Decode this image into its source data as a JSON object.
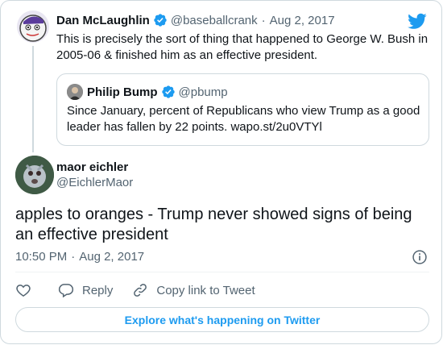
{
  "parent_tweet": {
    "name": "Dan McLaughlin",
    "handle": "@baseballcrank",
    "date": "Aug 2, 2017",
    "text": "This is precisely the sort of thing that happened to George W. Bush in 2005-06 & finished him as an effective president."
  },
  "quoted_tweet": {
    "name": "Philip Bump",
    "handle": "@pbump",
    "text": "Since January, percent of Republicans who view Trump as a good leader has fallen by 22 points. wapo.st/2u0VTYl"
  },
  "main_tweet": {
    "name": "maor eichler",
    "handle": "@EichlerMaor",
    "text": "apples to oranges - Trump never showed signs of being an effective president",
    "time": "10:50 PM",
    "date": "Aug 2, 2017"
  },
  "actions": {
    "reply_label": "Reply",
    "copy_label": "Copy link to Tweet"
  },
  "explore_label": "Explore what's happening on Twitter",
  "separator": "·",
  "icons": {
    "brand": "twitter-bird-icon",
    "verified": "verified-badge-icon",
    "info": "info-icon",
    "like": "heart-icon",
    "reply": "reply-bubble-icon",
    "copy": "link-icon"
  },
  "colors": {
    "brand": "#1d9bf0",
    "text": "#0f1419",
    "muted": "#536471",
    "border": "#cfd9de"
  }
}
